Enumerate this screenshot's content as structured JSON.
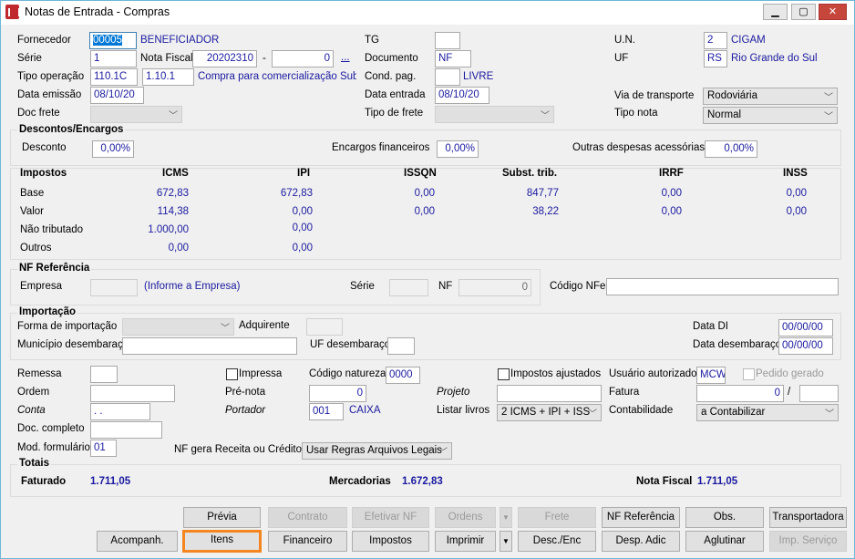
{
  "window": {
    "title": "Notas de Entrada - Compras",
    "minimize": "▁",
    "maximize": "▢",
    "close": "✕"
  },
  "header": {
    "fornecedor": {
      "label": "Fornecedor",
      "code": "00005",
      "name": "BENEFICIADOR"
    },
    "serie": {
      "label": "Série",
      "value": "1"
    },
    "nota_fiscal": {
      "label": "Nota Fiscal",
      "value": "20202310",
      "sep": "-",
      "suffix": "0",
      "lookup": "..."
    },
    "tipo_operacao": {
      "label": "Tipo operação",
      "code": "110.1C",
      "cfop": "1.10.1",
      "desc": "Compra para comercialização Subst. T"
    },
    "data_emissao": {
      "label": "Data emissão",
      "value": "08/10/20"
    },
    "doc_frete": {
      "label": "Doc frete",
      "value": ""
    },
    "tg": {
      "label": "TG",
      "value": ""
    },
    "documento": {
      "label": "Documento",
      "value": "NF"
    },
    "cond_pag": {
      "label": "Cond. pag.",
      "value": "",
      "desc": "LIVRE"
    },
    "data_entrada": {
      "label": "Data entrada",
      "value": "08/10/20"
    },
    "tipo_frete": {
      "label": "Tipo de frete",
      "value": ""
    },
    "un": {
      "label": "U.N.",
      "value": "2",
      "name": "CIGAM"
    },
    "uf": {
      "label": "UF",
      "value": "RS",
      "name": "Rio Grande do Sul"
    },
    "via_transporte": {
      "label": "Via de transporte",
      "value": "Rodoviária"
    },
    "tipo_nota": {
      "label": "Tipo nota",
      "value": "Normal"
    }
  },
  "descontos": {
    "title": "Descontos/Encargos",
    "desconto": {
      "label": "Desconto",
      "value": "0,00%"
    },
    "encargos": {
      "label": "Encargos financeiros",
      "value": "0,00%"
    },
    "outras": {
      "label": "Outras despesas acessórias",
      "value": "0,00%"
    }
  },
  "impostos": {
    "title": "Impostos",
    "columns": [
      "ICMS",
      "IPI",
      "ISSQN",
      "Subst. trib.",
      "IRRF",
      "INSS"
    ],
    "rows": [
      {
        "label": "Base",
        "values": [
          "672,83",
          "672,83",
          "0,00",
          "847,77",
          "0,00",
          "0,00"
        ]
      },
      {
        "label": "Valor",
        "values": [
          "114,38",
          "0,00",
          "0,00",
          "38,22",
          "0,00",
          "0,00"
        ]
      },
      {
        "label": "Não tributado",
        "values": [
          "1.000,00",
          "0,00"
        ]
      },
      {
        "label": "Outros",
        "values": [
          "0,00",
          "0,00"
        ]
      }
    ]
  },
  "nf_ref": {
    "title": "NF Referência",
    "empresa_label": "Empresa",
    "empresa_hint": "(Informe a Empresa)",
    "serie_label": "Série",
    "nf_label": "NF",
    "nf_value": "0",
    "codigo_nfe_label": "Código NFe",
    "codigo_nfe": ""
  },
  "importacao": {
    "title": "Importação",
    "forma_label": "Forma de importação",
    "adquirente_label": "Adquirente",
    "data_di_label": "Data DI",
    "data_di": "00/00/00",
    "municipio_label": "Município desembaraço",
    "uf_label": "UF desembaraço",
    "data_desemb_label": "Data desembaraço",
    "data_desemb": "00/00/00"
  },
  "extra": {
    "remessa": "Remessa",
    "impressa": "Impressa",
    "codigo_natureza": "Código natureza",
    "codigo_natureza_value": "0000",
    "impostos_ajustados": "Impostos ajustados",
    "usuario_autorizado": "Usuário autorizado",
    "usuario_value": "MCW",
    "pedido_gerado": "Pedido gerado",
    "ordem": "Ordem",
    "pre_nota": "Pré-nota",
    "pre_nota_value": "0",
    "projeto": "Projeto",
    "fatura": "Fatura",
    "fatura_value": "0",
    "fatura_sep": "/",
    "conta": "Conta",
    "conta_value": ". .",
    "portador": "Portador",
    "portador_value": "001",
    "portador_name": "CAIXA",
    "listar_livros": "Listar livros",
    "listar_livros_value": "2 ICMS + IPI + ISS",
    "contabilidade": "Contabilidade",
    "contabilidade_value": "a Contabilizar",
    "doc_completo": "Doc. completo",
    "mod_formulario": "Mod. formulário",
    "mod_formulario_value": "01",
    "nf_gera": "NF gera Receita ou Crédito",
    "nf_gera_value": "Usar Regras Arquivos Legais"
  },
  "totais": {
    "title": "Totais",
    "faturado_label": "Faturado",
    "faturado": "1.711,05",
    "mercadorias_label": "Mercadorias",
    "mercadorias": "1.672,83",
    "nota_fiscal_label": "Nota Fiscal",
    "nota_fiscal": "1.711,05"
  },
  "buttons": {
    "previa": "Prévia",
    "contrato": "Contrato",
    "efetivar": "Efetivar NF",
    "ordens": "Ordens",
    "frete": "Frete",
    "nf_referencia": "NF Referência",
    "obs": "Obs.",
    "transportadora": "Transportadora",
    "acompanh": "Acompanh.",
    "itens": "Itens",
    "financeiro": "Financeiro",
    "impostos": "Impostos",
    "imprimir": "Imprimir",
    "desc_enc": "Desc./Enc",
    "desp_adic": "Desp. Adic",
    "aglutinar": "Aglutinar",
    "imp_servico": "Imp. Serviço",
    "dropdown": "▼"
  },
  "colors": {
    "highlight": "#f5861f",
    "value_text": "#1a1aa0"
  }
}
